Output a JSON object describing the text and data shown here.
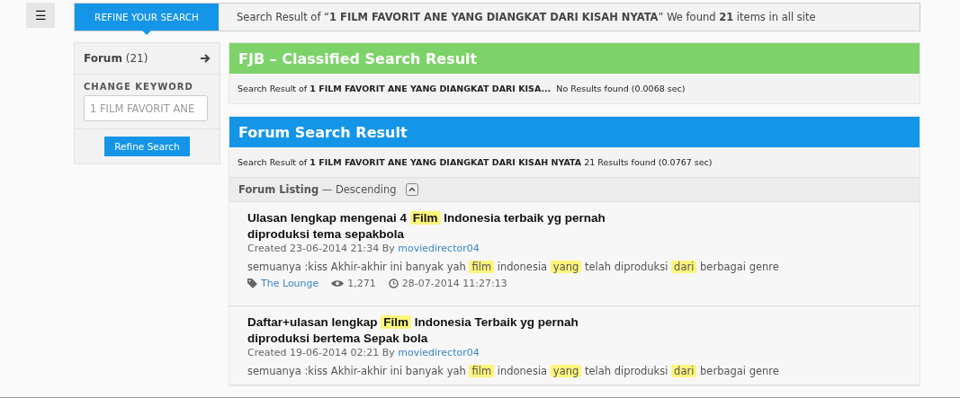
{
  "menu_button": {
    "icon": "☰"
  },
  "refine_tab": {
    "label": "REFINE YOUR SEARCH",
    "selected": true
  },
  "summary": "Search Result of “**1 FILM FAVORIT ANE YANG DIANGKAT DARI KISAH NYATA**” We found **21** items in all site",
  "sidebar": {
    "category": {
      "label": "Forum",
      "count": "(21)"
    },
    "keyword_heading": "CHANGE KEYWORD",
    "keyword_value": "1 FILM FAVORIT ANE",
    "button": "Refine Search"
  },
  "sections": [
    {
      "kind": "classified",
      "title": "FJB – Classified Search Result",
      "result": "Search Result of **1 FILM FAVORIT ANE YANG DIANGKAT DARI KISA...**  No Results found (0.0068 sec)"
    },
    {
      "kind": "forum",
      "title": "Forum Search Result",
      "result": "Search Result of **1 FILM FAVORIT ANE YANG DIANGKAT DARI KISAH NYATA** 21 Results found (0.0767 sec)"
    }
  ],
  "listing": {
    "label": "Forum Listing",
    "order": "— Descending",
    "expanded": true
  },
  "posts": [
    {
      "title": [
        {
          "text": "Ulasan lengkap mengenai 4 ",
          "highlight": false
        },
        {
          "text": "Film",
          "highlight": true
        },
        {
          "text": " Indonesia terbaik yg pernah diproduksi tema sepakbola",
          "highlight": false
        }
      ],
      "created": "Created 23-06-2014 21:34 By",
      "author": "moviedirector04",
      "snippet": [
        {
          "text": "semuanya :kiss Akhir-akhir ini banyak yah ",
          "highlight": false
        },
        {
          "text": "film",
          "highlight": true
        },
        {
          "text": " indonesia ",
          "highlight": false
        },
        {
          "text": "yang",
          "highlight": true
        },
        {
          "text": " telah diproduksi ",
          "highlight": false
        },
        {
          "text": "dari",
          "highlight": true
        },
        {
          "text": " berbagai genre",
          "highlight": false
        }
      ],
      "forum": "The Lounge",
      "views": "1,271",
      "updated": "28-07-2014 11:27:13"
    },
    {
      "title": [
        {
          "text": "Daftar+ulasan lengkap ",
          "highlight": false
        },
        {
          "text": "Film",
          "highlight": true
        },
        {
          "text": " Indonesia Terbaik yg pernah diproduksi bertema Sepak bola",
          "highlight": false
        }
      ],
      "created": "Created 19-06-2014 02:21 By",
      "author": "moviedirector04",
      "snippet": [
        {
          "text": "semuanya :kiss Akhir-akhir ini banyak yah ",
          "highlight": false
        },
        {
          "text": "film",
          "highlight": true
        },
        {
          "text": " indonesia ",
          "highlight": false
        },
        {
          "text": "yang",
          "highlight": true
        },
        {
          "text": " telah diproduksi ",
          "highlight": false
        },
        {
          "text": "dari",
          "highlight": true
        },
        {
          "text": " berbagai genre",
          "highlight": false
        }
      ]
    }
  ]
}
